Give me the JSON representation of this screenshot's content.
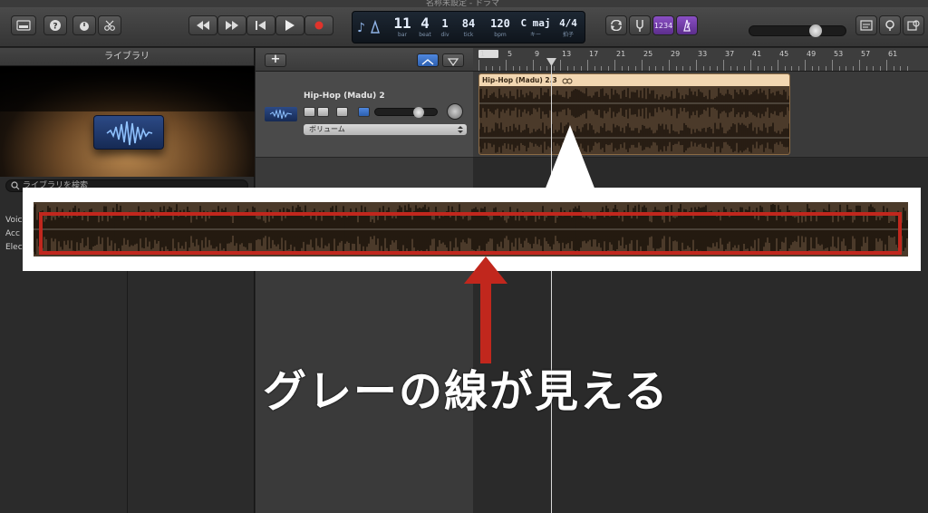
{
  "window": {
    "title": "名称未設定 - ドラマ"
  },
  "toolbar": {
    "library_tooltip": "library",
    "lcd": {
      "bar": "11",
      "bar_label": "bar",
      "beat": "4",
      "beat_label": "beat",
      "div": "1",
      "div_label": "div",
      "tick": "84",
      "tick_label": "tick",
      "bpm": "120",
      "bpm_label": "bpm",
      "key": "C maj",
      "key_label": "キー",
      "sig": "4/4",
      "sig_label": "拍子"
    },
    "count_in": "1234"
  },
  "library": {
    "header": "ライブラリ",
    "search_placeholder": "ライブラリを検索",
    "items": [
      "Voic",
      "Acc",
      "Elec"
    ]
  },
  "tracks": {
    "add_label": "+",
    "track": {
      "name": "Hip-Hop (Madu) 2",
      "automation": "ボリューム"
    }
  },
  "timeline": {
    "ruler": [
      "1",
      "5",
      "9",
      "13",
      "17",
      "21",
      "25",
      "29",
      "33",
      "37",
      "41",
      "45",
      "49",
      "53",
      "57",
      "61"
    ],
    "region_name": "Hip-Hop (Madu) 2.3"
  },
  "annotation": {
    "caption": "グレーの線が見える"
  },
  "colors": {
    "region_head": "#f2d7b2",
    "region_body": "#4b3a2a",
    "annotation_red": "#c1271d",
    "annotation_white": "#ffffff"
  }
}
